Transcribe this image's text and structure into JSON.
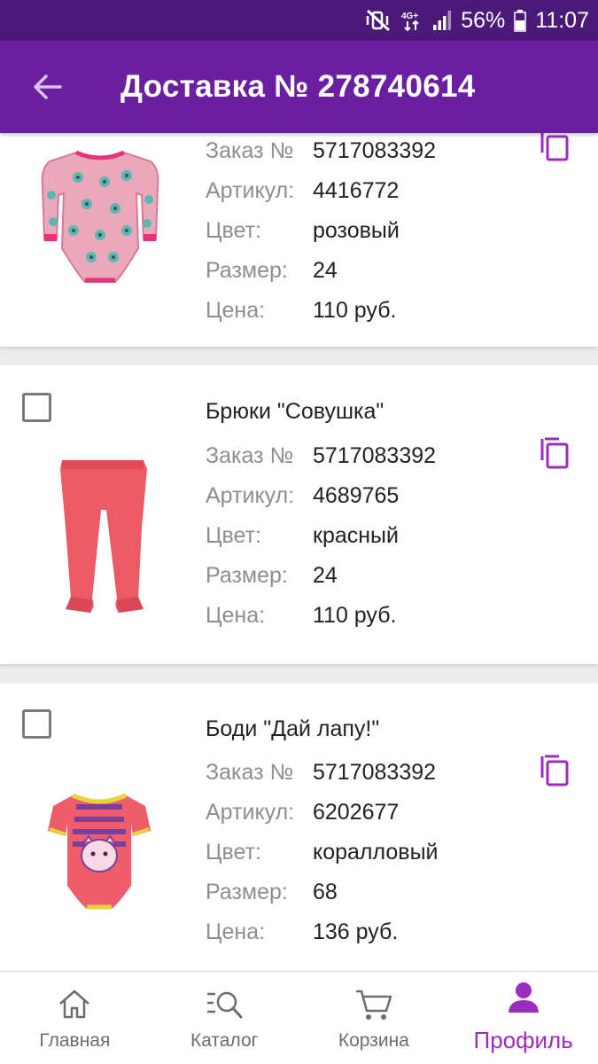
{
  "status_bar": {
    "battery": "56%",
    "time": "11:07",
    "network": "4G+",
    "icons": [
      "mute-vibrate-icon",
      "network-4g-icon",
      "signal-icon",
      "battery-icon"
    ]
  },
  "app_bar": {
    "title": "Доставка № 278740614",
    "back_icon": "arrow-left-icon"
  },
  "colors": {
    "status_bar": "#4b1a79",
    "app_bar": "#6a1fa0",
    "accent": "#9b2dbe"
  },
  "labels": {
    "order": "Заказ №",
    "article": "Артикул:",
    "color": "Цвет:",
    "size": "Размер:",
    "price": "Цена:"
  },
  "items": [
    {
      "name": "",
      "order": "5717083392",
      "article": "4416772",
      "color": "розовый",
      "size": "24",
      "price": "110 руб.",
      "image": "pink-owl-bodysuit-image"
    },
    {
      "name": "Брюки \"Совушка\"",
      "order": "5717083392",
      "article": "4689765",
      "color": "красный",
      "size": "24",
      "price": "110 руб.",
      "image": "red-pants-image"
    },
    {
      "name": "Боди \"Дай лапу!\"",
      "order": "5717083392",
      "article": "6202677",
      "color": "коралловый",
      "size": "68",
      "price": "136 руб.",
      "image": "coral-cat-bodysuit-image"
    }
  ],
  "bottom_nav": [
    {
      "label": "Главная",
      "icon": "home-icon",
      "active": false
    },
    {
      "label": "Каталог",
      "icon": "catalog-search-icon",
      "active": false
    },
    {
      "label": "Корзина",
      "icon": "cart-icon",
      "active": false
    },
    {
      "label": "Профиль",
      "icon": "profile-icon",
      "active": true
    }
  ]
}
